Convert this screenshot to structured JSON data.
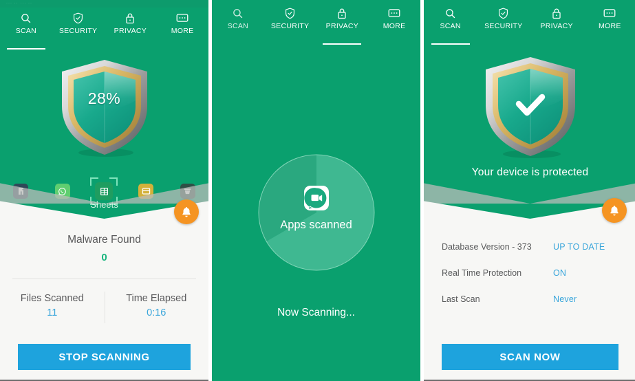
{
  "colors": {
    "green_bg": "#0aa06e",
    "card_bg": "#f7f7f5",
    "accent_blue": "#1ea3dd",
    "value_blue": "#3aa6db",
    "orange_fab": "#f59422",
    "malware_green": "#19b57e",
    "label_grey": "#59595a"
  },
  "tabs": [
    {
      "label": "SCAN",
      "icon": "search-icon"
    },
    {
      "label": "SECURITY",
      "icon": "shield-check-icon"
    },
    {
      "label": "PRIVACY",
      "icon": "lock-icon"
    },
    {
      "label": "MORE",
      "icon": "more-dots-icon"
    }
  ],
  "panel1": {
    "active_tab": "SCAN",
    "shield_percent": "28%",
    "scanning_app_name": "Sheets",
    "apps": [
      {
        "name": "phonepe-app-icon",
        "bg": "#2f4858",
        "glyph": "ব"
      },
      {
        "name": "whatsapp-app-icon",
        "bg": "#5fce70",
        "glyph": "whatsapp"
      },
      {
        "name": "sheets-app-icon",
        "bg": "#1f9d60",
        "glyph": "grid"
      },
      {
        "name": "notes-app-icon",
        "bg": "#d3b13a",
        "glyph": "window"
      },
      {
        "name": "basket-app-icon",
        "bg": "#2f4f46",
        "glyph": "basket"
      }
    ],
    "malware_label": "Malware Found",
    "malware_count": "0",
    "stats": [
      {
        "label": "Files Scanned",
        "value": "11"
      },
      {
        "label": "Time Elapsed",
        "value": "0:16"
      }
    ],
    "action_button": "STOP SCANNING",
    "bell_icon": "bell-icon"
  },
  "panel2": {
    "active_tab": "PRIVACY",
    "circle_label": "Apps scanned",
    "circle_app_icon": "duo-video-chat-icon",
    "status_text": "Now Scanning...",
    "progress_sector_degrees": 120
  },
  "panel3": {
    "active_tab": "SCAN",
    "headline": "Your device is protected",
    "shield_icon": "shield-check-icon",
    "bell_icon": "bell-icon",
    "info_rows": [
      {
        "label": "Database Version - 373",
        "value": "UP TO DATE"
      },
      {
        "label": "Real Time Protection",
        "value": "ON"
      },
      {
        "label": "Last Scan",
        "value": "Never"
      }
    ],
    "action_button": "SCAN NOW"
  },
  "statusbar": {
    "dots": "··· ·· ··· ··"
  }
}
